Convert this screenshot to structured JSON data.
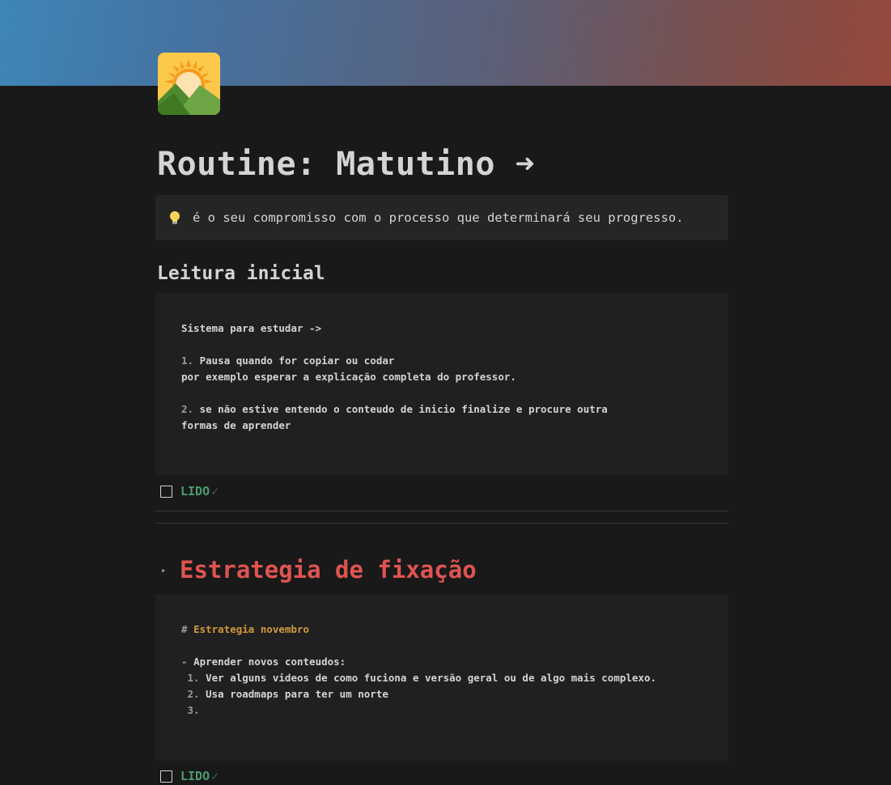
{
  "page": {
    "title": "Routine: Matutino ➜",
    "icon": "sunrise-over-mountains-icon"
  },
  "callout": {
    "icon": "lightbulb-icon",
    "text": "é o seu compromisso com o processo que determinará seu progresso."
  },
  "section1": {
    "heading": "Leitura inicial",
    "code_lines": [
      {
        "num": "",
        "text": "Sistema para estudar ->"
      },
      {
        "num": "",
        "text": ""
      },
      {
        "num": "1.",
        "text": " Pausa quando for copiar ou codar"
      },
      {
        "num": "",
        "text": "por exemplo esperar a explicação completa do professor."
      },
      {
        "num": "",
        "text": ""
      },
      {
        "num": "2.",
        "text": " se não estive entendo o conteudo de inicio finalize e procure outra"
      },
      {
        "num": "",
        "text": "formas de aprender"
      }
    ],
    "todo": {
      "label": "LIDO",
      "check": "✓",
      "checked": false
    }
  },
  "section2": {
    "toggle_arrow": "▸",
    "heading": "Estrategia de fixação",
    "code_lines": [
      {
        "num": "# ",
        "text": "Estrategia novembro",
        "style": "orange"
      },
      {
        "num": "",
        "text": ""
      },
      {
        "num": "- ",
        "text": "Aprender novos conteudos:"
      },
      {
        "num": " 1.",
        "text": " Ver alguns videos de como fuciona e versão geral ou de algo mais complexo."
      },
      {
        "num": " 2.",
        "text": " Usa roadmaps para ter um norte"
      },
      {
        "num": " 3.",
        "text": ""
      }
    ],
    "todo": {
      "label": "LIDO",
      "check": "✓",
      "checked": false
    }
  },
  "colors": {
    "background": "#191919",
    "heading_red": "#df5452",
    "todo_green": "#4e9a6f",
    "code_orange": "#d29a3a"
  }
}
